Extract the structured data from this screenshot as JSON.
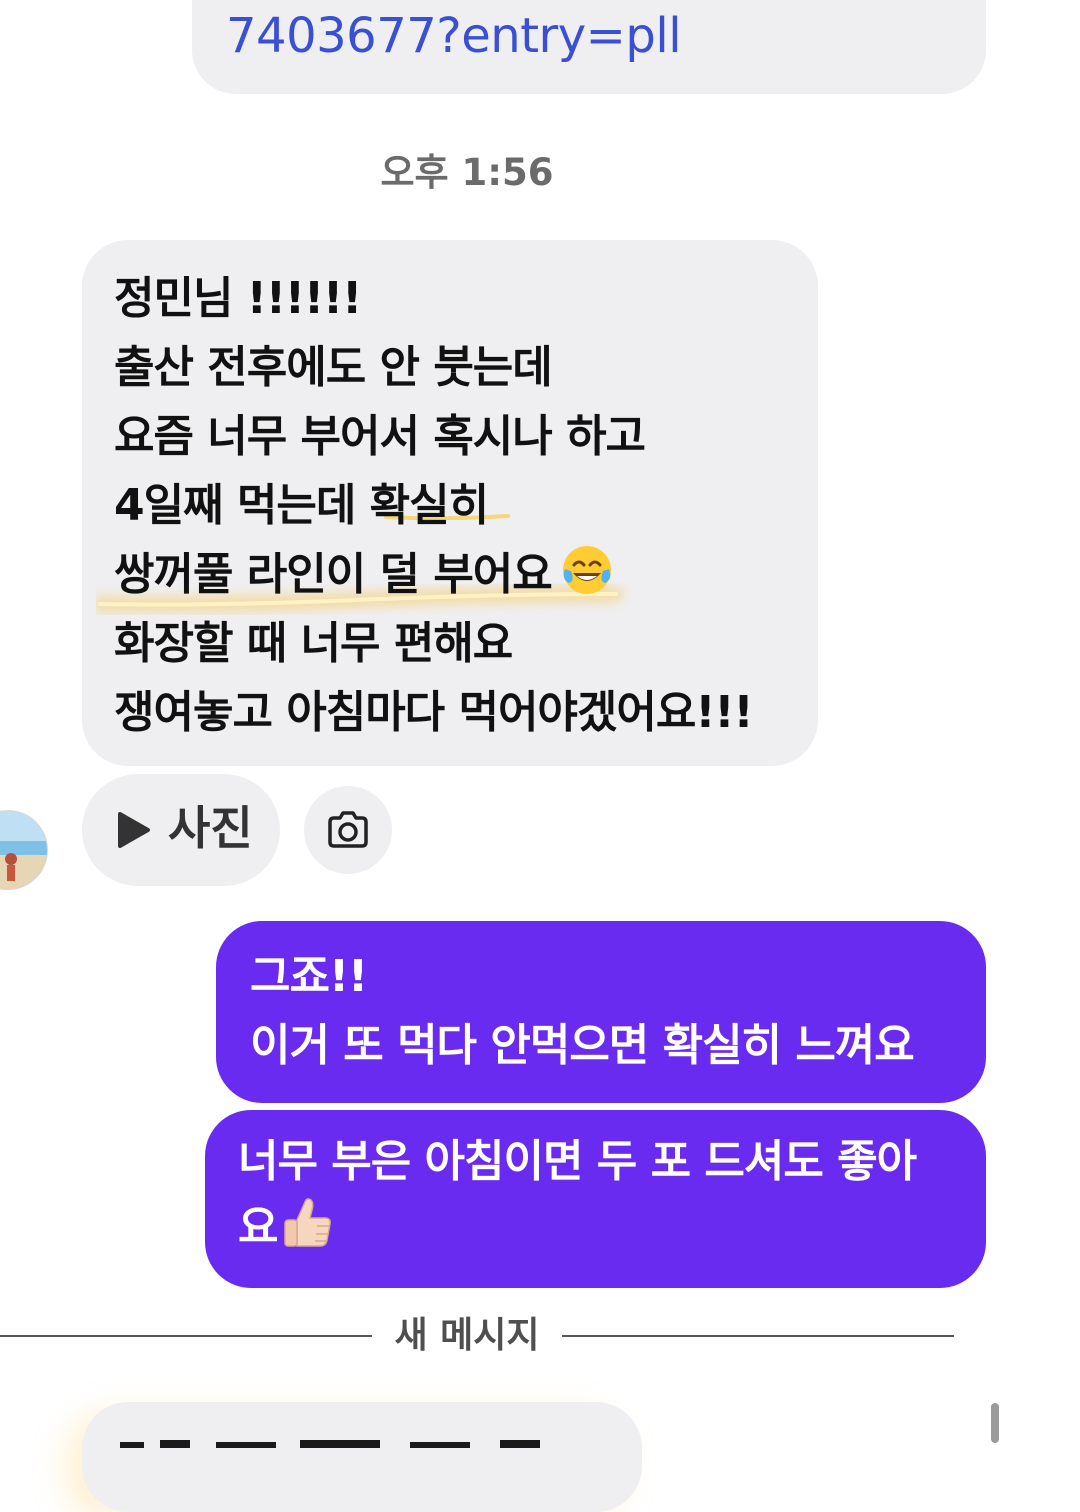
{
  "top_message": {
    "link_text": "7403677?entry=pll"
  },
  "timestamp": "오후 1:56",
  "incoming_message": {
    "lines": [
      "정민님 !!!!!!",
      "출산 전후에도 안 붓는데",
      "요즘 너무 부어서 혹시나 하고",
      "4일째 먹는데 확실히",
      "쌍꺼풀 라인이 덜 부어요",
      "화장할 때 너무 편해요",
      "쟁여놓고 아침마다 먹어야겠어요!!!"
    ],
    "emoji": "laughing-tears-emoji",
    "highlight_color": "#f6c453"
  },
  "attachments": {
    "photo_label": "사진",
    "play_icon": "play-icon",
    "camera_icon": "camera-icon"
  },
  "outgoing_messages": [
    {
      "lines": [
        "그죠!!",
        "이거 또 먹다 안먹으면 확실히 느껴요"
      ]
    },
    {
      "lines": [
        "너무 부은 아침이면 두 포 드셔도 좋아",
        "요"
      ],
      "emoji": "thumbs-up-emoji"
    }
  ],
  "divider_label": "새 메시지",
  "colors": {
    "outgoing_bubble": "#6a2bf0",
    "incoming_bubble": "#efeff1",
    "link": "#3a4fd4"
  }
}
